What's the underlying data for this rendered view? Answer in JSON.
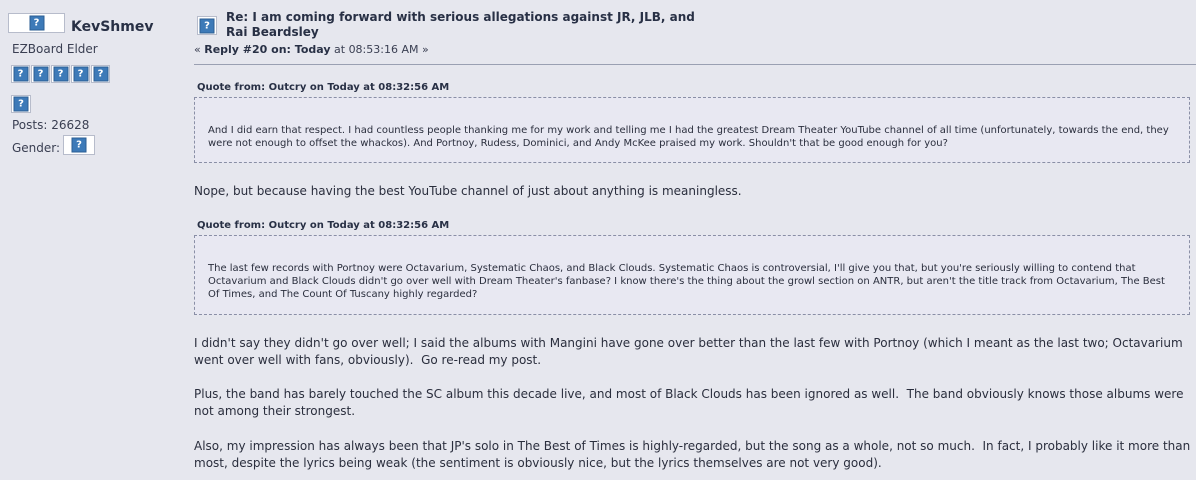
{
  "poster": {
    "avatar_icon": "image-placeholder-icon",
    "username": "KevShmev",
    "rank": "EZBoard Elder",
    "rank_star_count": 5,
    "posts_label": "Posts: 26628",
    "gender_label": "Gender:"
  },
  "post": {
    "subject_line1": "Re: I am coming forward with serious allegations against JR, JLB, and",
    "subject_line2": "Rai Beardsley",
    "reply_prefix": "« ",
    "reply_number": "Reply #20 on: Today",
    "reply_time": " at 08:53:16 AM »",
    "quotes": [
      {
        "header": "Quote from: Outcry on Today at 08:32:56 AM",
        "text": "And I did earn that respect. I had countless people thanking me for my work and telling me I had the greatest Dream Theater YouTube channel of all time (unfortunately, towards the end, they were not enough to offset the whackos). And Portnoy, Rudess, Dominici, and Andy McKee praised my work. Shouldn't that be good enough for you?"
      },
      {
        "header": "Quote from: Outcry on Today at 08:32:56 AM",
        "text": "The last few records with Portnoy were Octavarium, Systematic Chaos, and Black Clouds. Systematic Chaos is controversial, I'll give you that, but you're seriously willing to contend that Octavarium and Black Clouds didn't go over well with Dream Theater's fanbase? I know there's the thing about the growl section on ANTR, but aren't the title track from Octavarium, The Best Of Times, and The Count Of Tuscany highly regarded?"
      }
    ],
    "reply_after_quote1": "Nope, but because having the best YouTube channel of just about anything is meaningless.",
    "paragraphs": [
      "I didn't say they didn't go over well; I said the albums with Mangini have gone over better than the last few with Portnoy (which I meant as the last two; Octavarium went over well with fans, obviously).  Go re-read my post.",
      "Plus, the band has barely touched the SC album this decade live, and most of Black Clouds has been ignored as well.  The band obviously knows those albums were not among their strongest.",
      "Also, my impression has always been that JP's solo in The Best of Times is highly-regarded, but the song as a whole, not so much.  In fact, I probably like it more than most, despite the lyrics being weak (the sentiment is obviously nice, but the lyrics themselves are not very good)."
    ]
  }
}
